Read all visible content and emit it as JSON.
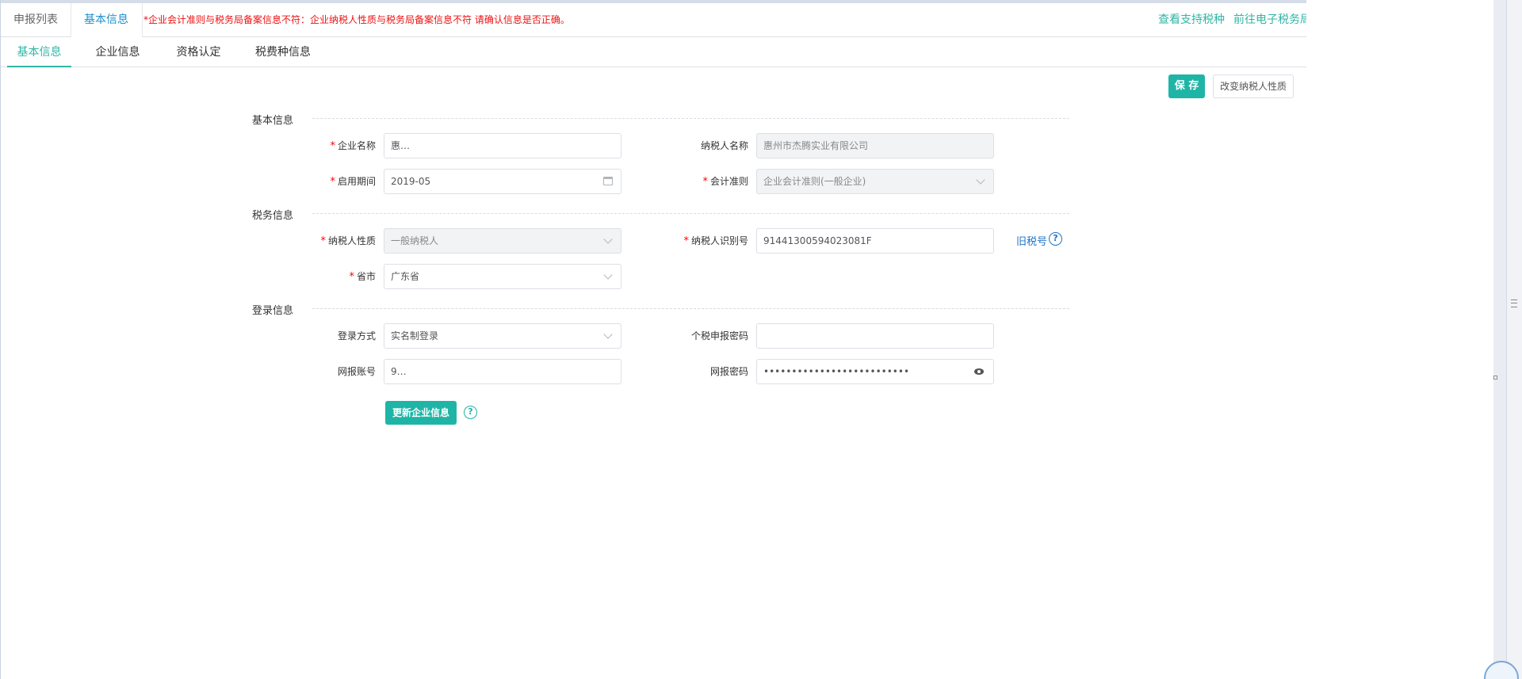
{
  "top_tabs": [
    "申报列表",
    "基本信息"
  ],
  "warning": "*企业会计准则与税务局备案信息不符：企业纳税人性质与税务局备案信息不符 请确认信息是否正确。",
  "top_links": [
    "查看支持税种",
    "前往电子税务局"
  ],
  "sub_tabs": [
    "基本信息",
    "企业信息",
    "资格认定",
    "税费种信息"
  ],
  "actions": {
    "save": "保 存",
    "change_nature": "改变纳税人性质"
  },
  "sections": {
    "basic": "基本信息",
    "tax": "税务信息",
    "login": "登录信息"
  },
  "fields": {
    "company_name": {
      "label": "企业名称",
      "value": "惠…"
    },
    "taxpayer_name": {
      "label": "纳税人名称",
      "value": "惠州市杰腾实业有限公司"
    },
    "enable_period": {
      "label": "启用期间",
      "value": "2019-05"
    },
    "accounting_standard": {
      "label": "会计准则",
      "value": "企业会计准则(一般企业)"
    },
    "taxpayer_nature": {
      "label": "纳税人性质",
      "value": "一般纳税人"
    },
    "taxpayer_id": {
      "label": "纳税人识别号",
      "value": "91441300594023081F"
    },
    "old_tax_no": "旧税号",
    "province": {
      "label": "省市",
      "value": "广东省"
    },
    "login_method": {
      "label": "登录方式",
      "value": "实名制登录"
    },
    "pit_password": {
      "label": "个税申报密码",
      "value": ""
    },
    "online_account": {
      "label": "网报账号",
      "value": "9…"
    },
    "online_password": {
      "label": "网报密码",
      "value": "••••••••••••••••••••••••••"
    }
  },
  "update_button": "更新企业信息",
  "help_glyph": "?",
  "colors": {
    "accent": "#1fb5a6",
    "warning": "#ee1111",
    "link": "#1e73c7"
  }
}
